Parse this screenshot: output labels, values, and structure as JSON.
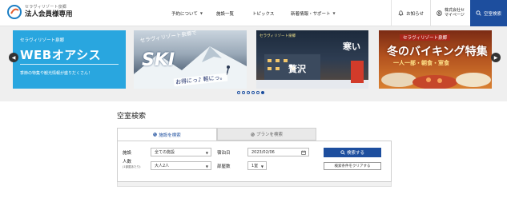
{
  "header": {
    "logo_sub": "セラヴィリゾート泉郷",
    "logo_main": "法人会員様専用",
    "nav": [
      {
        "label": "予約について"
      },
      {
        "label": "施設一覧"
      },
      {
        "label": "トピックス"
      },
      {
        "label": "新着情報・サポート"
      }
    ],
    "notice_label": "お知らせ",
    "mypage_line1": "株式会社セ",
    "mypage_line2": "マイページ",
    "search_label": "空室検索"
  },
  "carousel": {
    "slides": [
      {
        "tag": "セラヴィリゾート泉郷",
        "title": "WEBオアシス",
        "desc": "季節の特集や観光情報が盛りだくさん！"
      },
      {
        "caption": "セラヴィリゾート泉郷で",
        "title": "SKI",
        "footer": "お得にっ♪ 軽にっ。"
      },
      {
        "tag": "セラヴィリゾート泉郷",
        "title": "寒い",
        "sub": "贅沢"
      },
      {
        "tag": "セラヴィリゾート泉郷",
        "title": "冬のバイキング特集",
        "sub": "一人一部・朝食・室食"
      }
    ],
    "dot_count": 6,
    "active_dot": 5
  },
  "search": {
    "section_title": "空室検索",
    "tab_facility": "施設を検索",
    "tab_plan": "プランを検索",
    "facility_label": "施設",
    "facility_value": "全ての施設",
    "checkin_label": "宿泊日",
    "checkin_value": "2023/02/06",
    "people_label": "人数",
    "people_note": "(1部屋あたり)",
    "people_value": "大人2人",
    "rooms_label": "部屋数",
    "rooms_value": "1室",
    "search_button": "検索する",
    "clear_button": "検索条件をクリアする"
  }
}
